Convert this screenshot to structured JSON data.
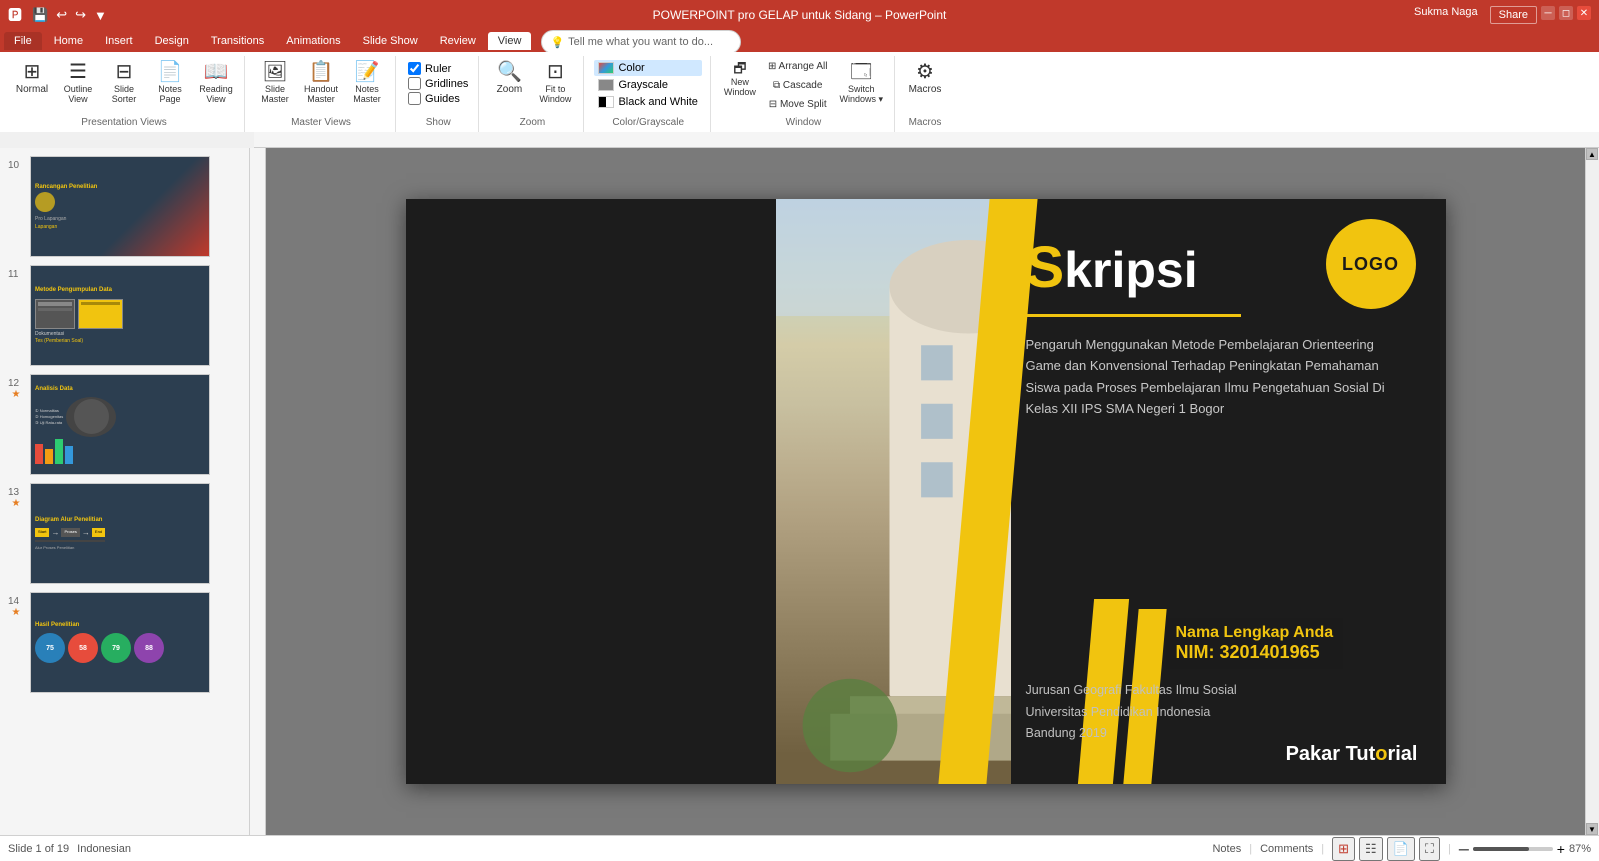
{
  "titlebar": {
    "title": "POWERPOINT pro GELAP untuk Sidang – PowerPoint",
    "qat": [
      "save",
      "undo",
      "redo",
      "customize"
    ],
    "user": "Sukma Naga",
    "share": "Share",
    "controls": [
      "minimize",
      "restore",
      "close"
    ]
  },
  "ribbon": {
    "tabs": [
      "File",
      "Home",
      "Insert",
      "Design",
      "Transitions",
      "Animations",
      "Slide Show",
      "Review",
      "View"
    ],
    "active_tab": "View",
    "tell_me": "Tell me what you want to do...",
    "groups": {
      "presentation_views": {
        "label": "Presentation Views",
        "buttons": [
          "Normal",
          "Outline View",
          "Slide Sorter",
          "Notes Page",
          "Reading View"
        ]
      },
      "master_views": {
        "label": "Master Views",
        "buttons": [
          "Slide Master",
          "Handout Master",
          "Notes Master"
        ]
      },
      "show": {
        "label": "Show",
        "checkboxes": [
          "Ruler",
          "Gridlines",
          "Guides"
        ]
      },
      "zoom": {
        "label": "Zoom",
        "buttons": [
          "Zoom",
          "Fit to Window"
        ]
      },
      "color": {
        "label": "Color/Grayscale",
        "options": [
          "Color",
          "Grayscale",
          "Black and White"
        ]
      },
      "window": {
        "label": "Window",
        "buttons": [
          "New Window",
          "Arrange All",
          "Cascade",
          "Move Split",
          "Switch Windows"
        ]
      },
      "macros": {
        "label": "Macros",
        "buttons": [
          "Macros"
        ]
      }
    }
  },
  "slide_panel": {
    "slides": [
      {
        "num": "10",
        "title": "Rancangan Penelitian",
        "starred": false
      },
      {
        "num": "11",
        "title": "Metode Pengumpulan Data",
        "starred": false
      },
      {
        "num": "12",
        "title": "Analisis Data",
        "starred": true
      },
      {
        "num": "13",
        "title": "Diagram Alur Penelitian",
        "starred": true
      },
      {
        "num": "14",
        "title": "Hasil Penelitian",
        "starred": true
      }
    ]
  },
  "slide": {
    "logo": "LOGO",
    "title_s": "S",
    "title_rest": "kripsi",
    "description": "Pengaruh Menggunakan Metode Pembelajaran Orienteering Game dan Konvensional Terhadap Peningkatan Pemahaman Siswa pada Proses Pembelajaran Ilmu Pengetahuan Sosial Di Kelas XII IPS SMA Negeri 1 Bogor",
    "name_line1": "Nama Lengkap Anda",
    "name_line2": "NIM: 3201401965",
    "university_line1": "Jurusan Geografi  Fakultas Ilmu Sosial",
    "university_line2": "Universitas Pendidikan Indonesia",
    "university_line3": "Bandung 2019",
    "watermark": "PakarTut",
    "watermark2": "rial"
  },
  "status": {
    "slide_info": "Slide 1 of 19",
    "language": "Indonesian",
    "notes": "Notes",
    "comments": "Comments",
    "zoom": "87%",
    "view_icons": [
      "normal",
      "outline",
      "reading",
      "fullscreen"
    ]
  }
}
